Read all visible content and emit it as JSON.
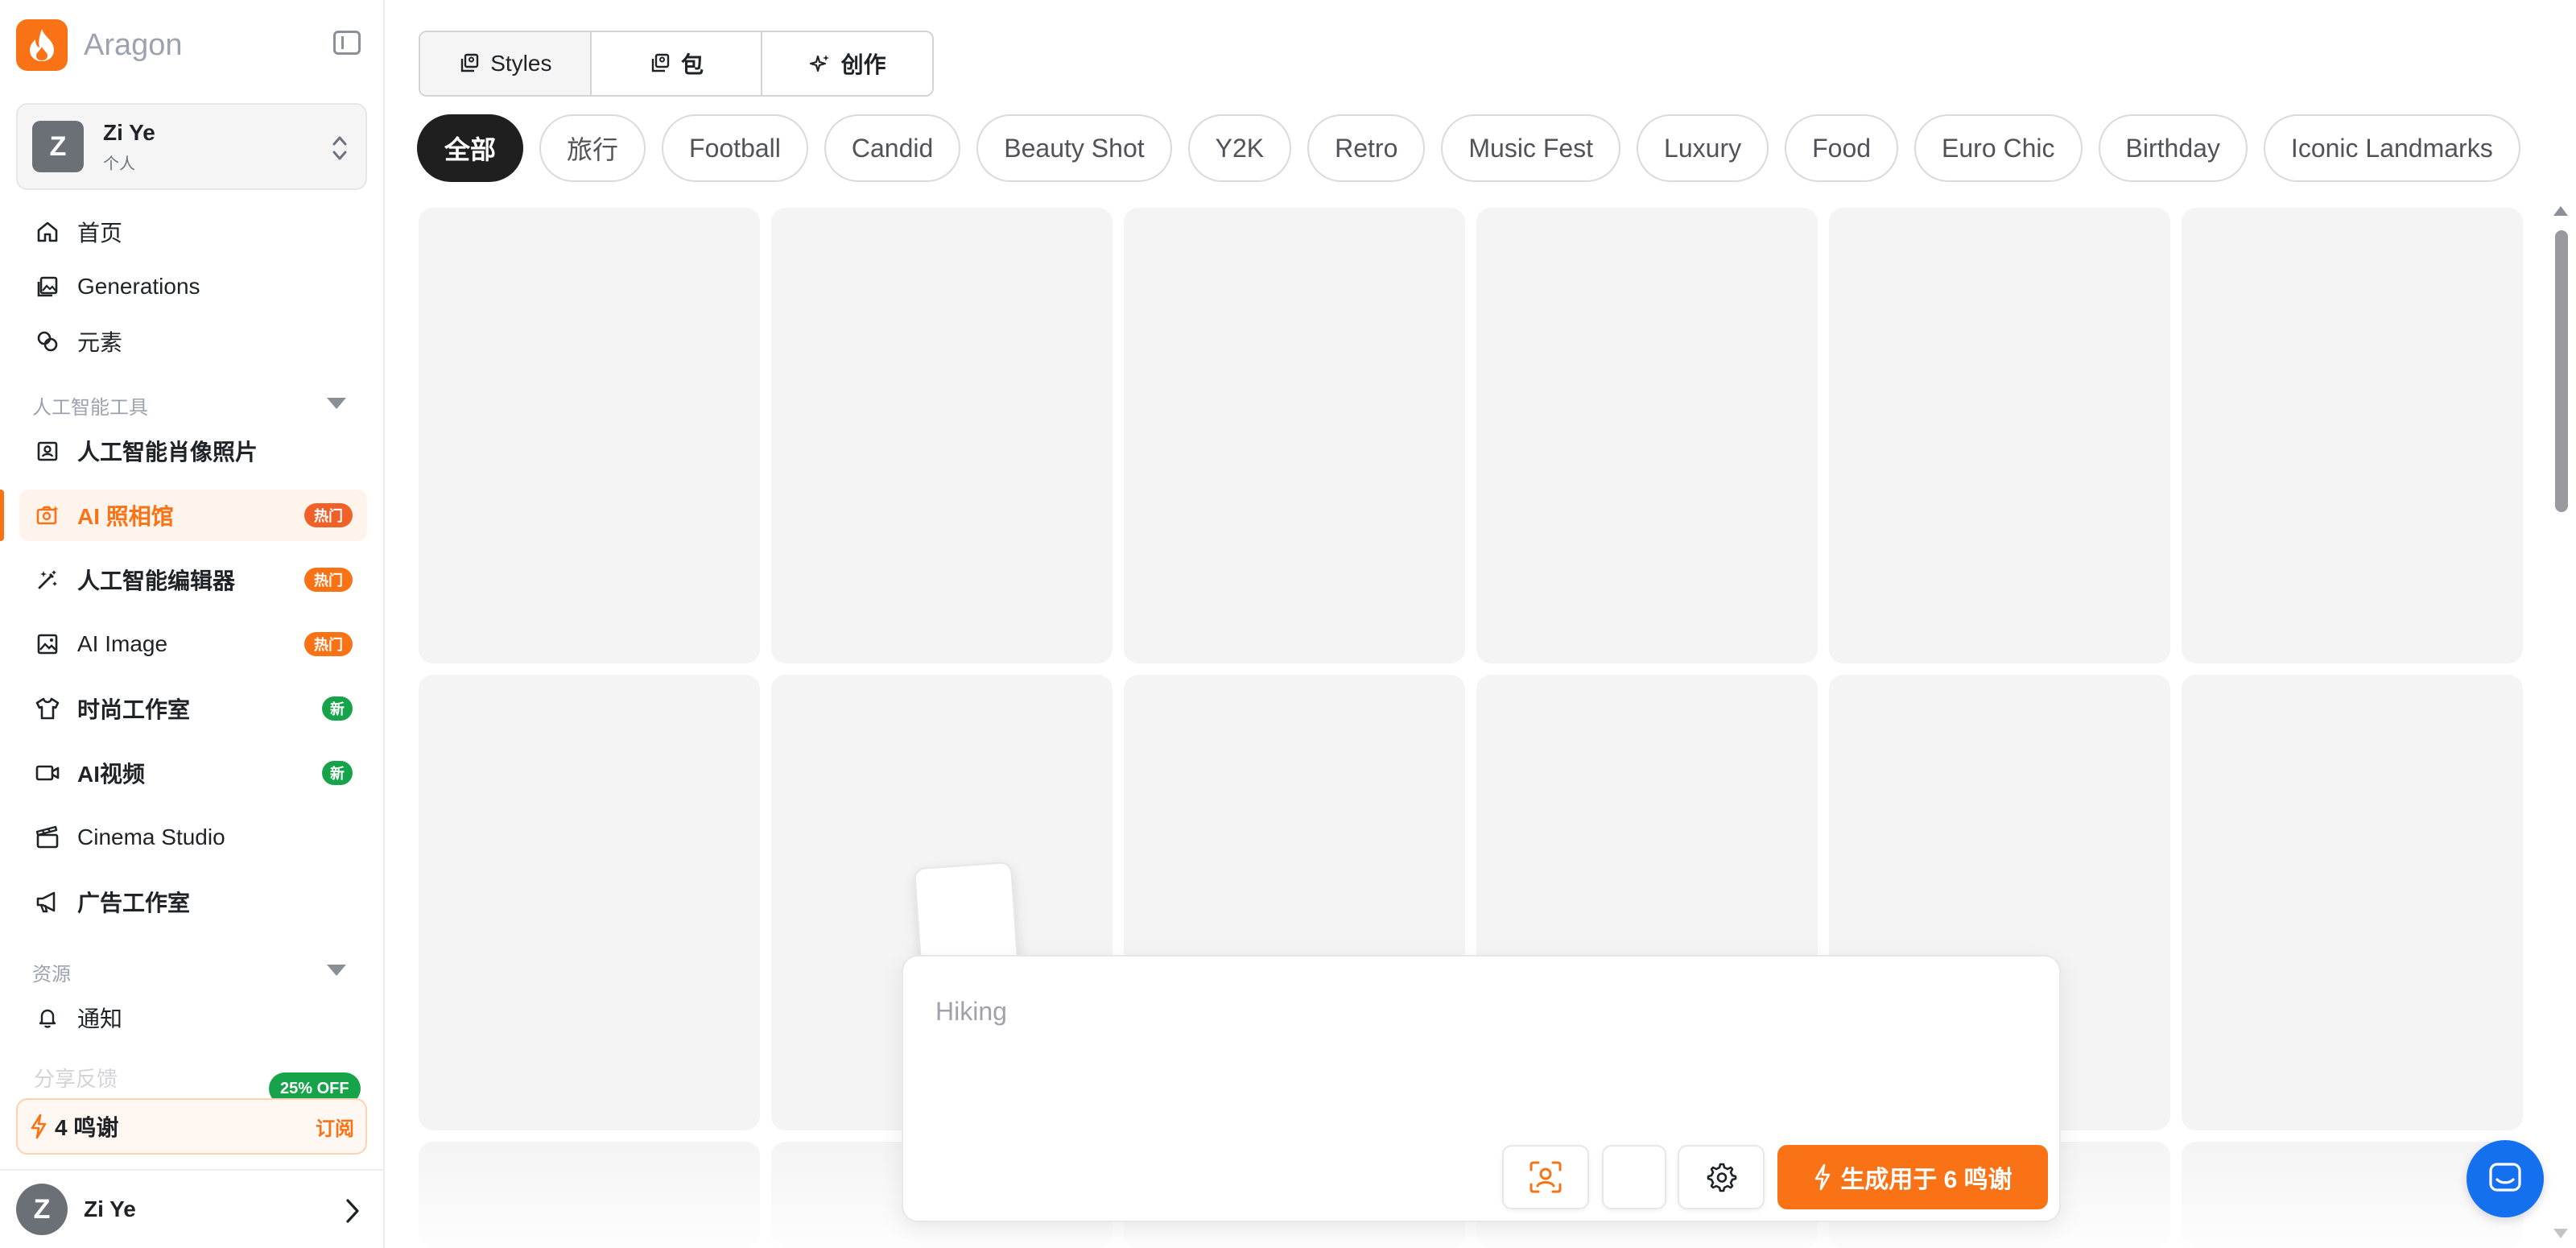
{
  "brand": {
    "name": "Aragon",
    "accent": "#f97316"
  },
  "account": {
    "initial": "Z",
    "name": "Zi Ye",
    "type": "个人"
  },
  "nav": {
    "home": "首页",
    "generations": "Generations",
    "elements": "元素",
    "ai_tools_header": "人工智能工具",
    "ai_portrait": "人工智能肖像照片",
    "ai_studio": "AI 照相馆",
    "ai_studio_badge": "热门",
    "ai_editor": "人工智能编辑器",
    "ai_editor_badge": "热门",
    "ai_image": "AI Image",
    "ai_image_badge": "热门",
    "fashion_studio": "时尚工作室",
    "fashion_badge": "新",
    "ai_video": "AI视频",
    "ai_video_badge": "新",
    "cinema_studio": "Cinema Studio",
    "ad_studio": "广告工作室",
    "resources_header": "资源",
    "notifications": "通知",
    "faded_item": "分享反馈"
  },
  "credits": {
    "label": "4 鸣谢",
    "action": "订阅",
    "promo": "25% OFF"
  },
  "footer_user": {
    "initial": "Z",
    "name": "Zi Ye"
  },
  "mode_tabs": {
    "styles": "Styles",
    "packs": "包",
    "create": "创作"
  },
  "categories": [
    "全部",
    "旅行",
    "Football",
    "Candid",
    "Beauty Shot",
    "Y2K",
    "Retro",
    "Music Fest",
    "Luxury",
    "Food",
    "Euro Chic",
    "Birthday",
    "Iconic Landmarks"
  ],
  "prompt": {
    "placeholder": "Hiking",
    "generate_label": "生成用于 6 鸣谢"
  },
  "colors": {
    "hot": "#f97316",
    "new": "#16a34a",
    "chat": "#1570ef"
  }
}
